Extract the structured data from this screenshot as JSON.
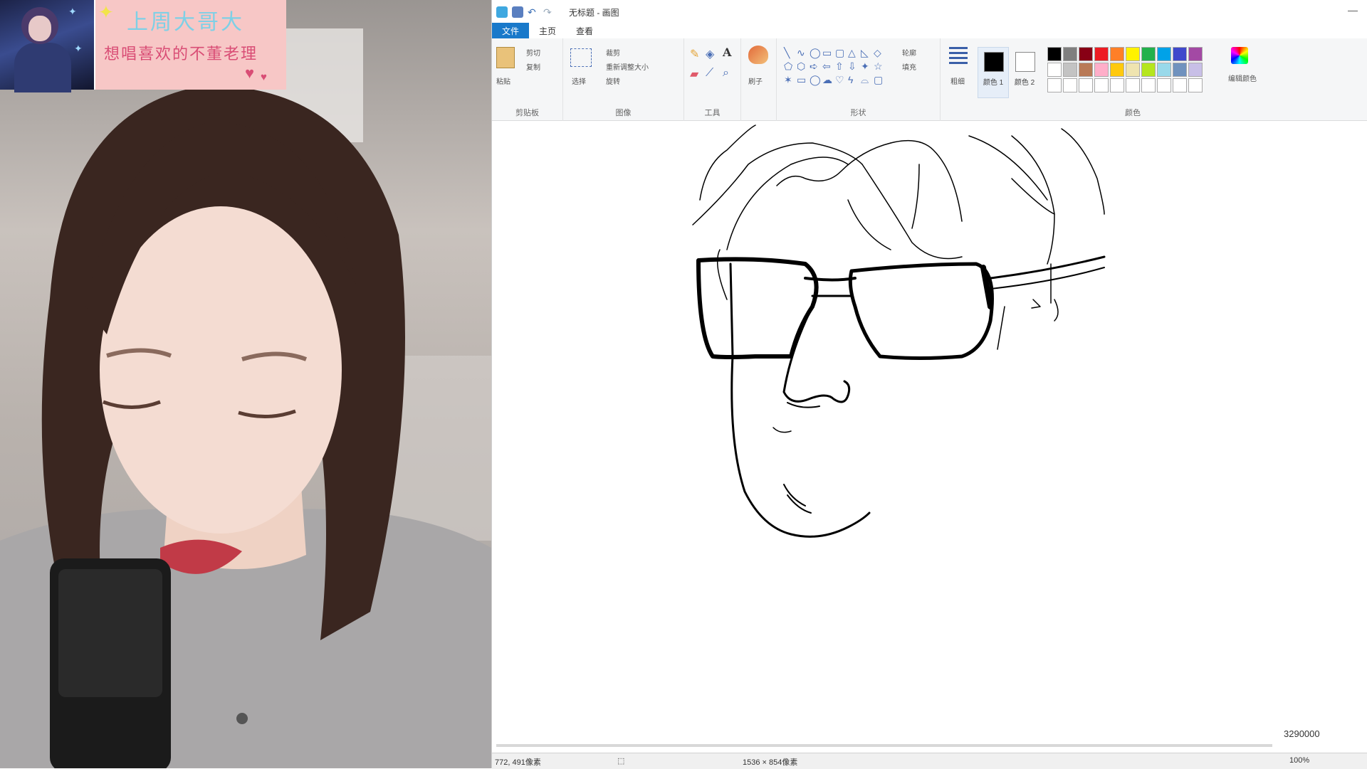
{
  "overlay": {
    "banner_title": "上周大哥大",
    "banner_subtitle": "想唱喜欢的不董老理"
  },
  "paint": {
    "window_title": "无标题 - 画图",
    "tabs": [
      "文件",
      "主页",
      "查看"
    ],
    "groups": {
      "clipboard": {
        "label": "剪贴板",
        "paste": "粘贴",
        "cut": "剪切",
        "copy": "复制"
      },
      "image": {
        "label": "图像",
        "select": "选择",
        "crop": "裁剪",
        "resize": "重新调整大小",
        "rotate": "旋转"
      },
      "tools": {
        "label": "工具"
      },
      "brushes": {
        "label": "刷子"
      },
      "shapes": {
        "label": "形状",
        "outline": "轮廓",
        "fill": "填充"
      },
      "size": {
        "label": "粗细"
      },
      "color1": {
        "label": "颜色 1"
      },
      "color2": {
        "label": "颜色 2"
      },
      "colors": {
        "label": "颜色"
      },
      "edit_colors": {
        "label": "编辑颜色"
      }
    },
    "palette": [
      "#000000",
      "#7f7f7f",
      "#880015",
      "#ed1c24",
      "#ff7f27",
      "#fff200",
      "#22b14c",
      "#00a2e8",
      "#3f48cc",
      "#a349a4",
      "#ffffff",
      "#c3c3c3",
      "#b97a57",
      "#ffaec9",
      "#ffc90e",
      "#efe4b0",
      "#b5e61d",
      "#99d9ea",
      "#7092be",
      "#c8bfe7",
      "#ffffff",
      "#ffffff",
      "#ffffff",
      "#ffffff",
      "#ffffff",
      "#ffffff",
      "#ffffff",
      "#ffffff",
      "#ffffff",
      "#ffffff"
    ],
    "status": {
      "cursor": "772, 491像素",
      "canvas_size": "1536 × 854像素",
      "zoom": "100%"
    },
    "watermark": "3290000"
  }
}
